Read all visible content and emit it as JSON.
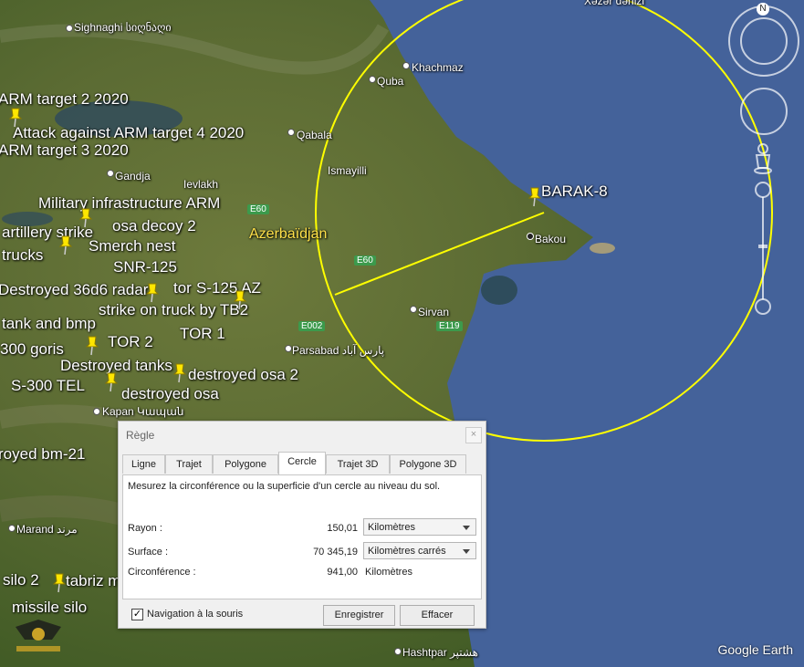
{
  "map": {
    "country_label": "Azerbaïdjan",
    "sea_label": "Xəzər dənizi",
    "cities": [
      {
        "name": "Sighnaghi სიღნაღი"
      },
      {
        "name": "Khachmaz"
      },
      {
        "name": "Quba"
      },
      {
        "name": "Qabala"
      },
      {
        "name": "Ismayilli"
      },
      {
        "name": "Gandja"
      },
      {
        "name": "Ievlakh"
      },
      {
        "name": "Bakou"
      },
      {
        "name": "Sirvan"
      },
      {
        "name": "Parsabad پارس آباد"
      },
      {
        "name": "Kapan Կապան"
      },
      {
        "name": "Marand مرند"
      },
      {
        "name": "Hashtpar هشتپر"
      }
    ],
    "roads": [
      "E60",
      "E60",
      "E002",
      "E119"
    ],
    "placemarks": [
      "ARM target 2 2020",
      "Attack against ARM target 4 2020",
      "ARM target 3 2020",
      "Military infrastructure ARM",
      "osa decoy 2",
      "artillery strike",
      "Smerch nest",
      "trucks",
      "SNR-125",
      "Destroyed 36d6 radar",
      "tor",
      "S-125 AZ",
      "strike on truck by TB2",
      "tank and bmp",
      "TOR 1",
      "300 goris",
      "TOR 2",
      "Destroyed tanks",
      "destroyed osa 2",
      "S-300 TEL",
      "destroyed osa",
      "royed bm-21",
      "silo 2",
      "tabriz m",
      "missile silo",
      "BARAK-8"
    ],
    "circle_color": "#ffff00",
    "brand": "Google Earth",
    "compass_letter": "N"
  },
  "dialog": {
    "title": "Règle",
    "close": "×",
    "tabs": [
      "Ligne",
      "Trajet",
      "Polygone",
      "Cercle",
      "Trajet 3D",
      "Polygone 3D"
    ],
    "active_tab": "Cercle",
    "description": "Mesurez la circonférence ou la superficie d'un cercle au niveau du sol.",
    "rows": {
      "radius": {
        "label": "Rayon :",
        "value": "150,01",
        "unit": "Kilomètres"
      },
      "area": {
        "label": "Surface :",
        "value": "70 345,19",
        "unit": "Kilomètres carrés"
      },
      "circumference": {
        "label": "Circonférence :",
        "value": "941,00",
        "unit": "Kilomètres"
      }
    },
    "mouse_nav": {
      "label": "Navigation à la souris",
      "checked": true,
      "mark": "✓"
    },
    "save_button": "Enregistrer",
    "clear_button": "Effacer"
  }
}
